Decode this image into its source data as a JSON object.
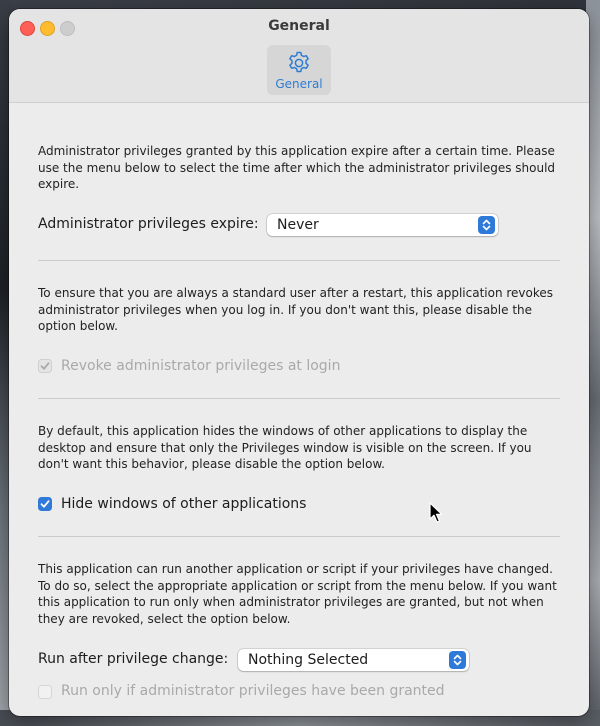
{
  "window": {
    "title": "General"
  },
  "toolbar": {
    "tabs": [
      {
        "label": "General",
        "icon": "gear-icon",
        "selected": true
      }
    ]
  },
  "sections": {
    "expire": {
      "description": "Administrator privileges granted by this application expire after a certain time. Please use the menu below to select the time after which the administrator privileges should expire.",
      "label": "Administrator privileges expire:",
      "selected_value": "Never"
    },
    "revoke": {
      "description": "To ensure that you are always a standard user after a restart, this application revokes administrator privileges when you log in. If you don't want this, please disable the option below.",
      "checkbox_label": "Revoke administrator privileges at login",
      "checked": true,
      "enabled": false
    },
    "hide": {
      "description": "By default, this application hides the windows of other applications to display the desktop and ensure that only the Privileges window is visible on the screen. If you don't want this behavior, please disable the option below.",
      "checkbox_label": "Hide windows of other applications",
      "checked": true,
      "enabled": true
    },
    "run": {
      "description": "This application can run another application or script if your privileges have changed. To do so, select the appropriate application or script from the menu below. If you want this application to run only when administrator privileges are granted, but not when they are revoked, select the option below.",
      "label": "Run after privilege change:",
      "selected_value": "Nothing Selected",
      "checkbox_label": "Run only if administrator privileges have been granted",
      "checked": false,
      "enabled": false
    }
  },
  "colors": {
    "accent": "#2f7ad9",
    "close": "#fe5f57",
    "minimize": "#febc2e",
    "zoom_inactive": "#cdcdcd",
    "disabled_text": "#a9a9a9",
    "tab_label": "#2f7cd3"
  }
}
